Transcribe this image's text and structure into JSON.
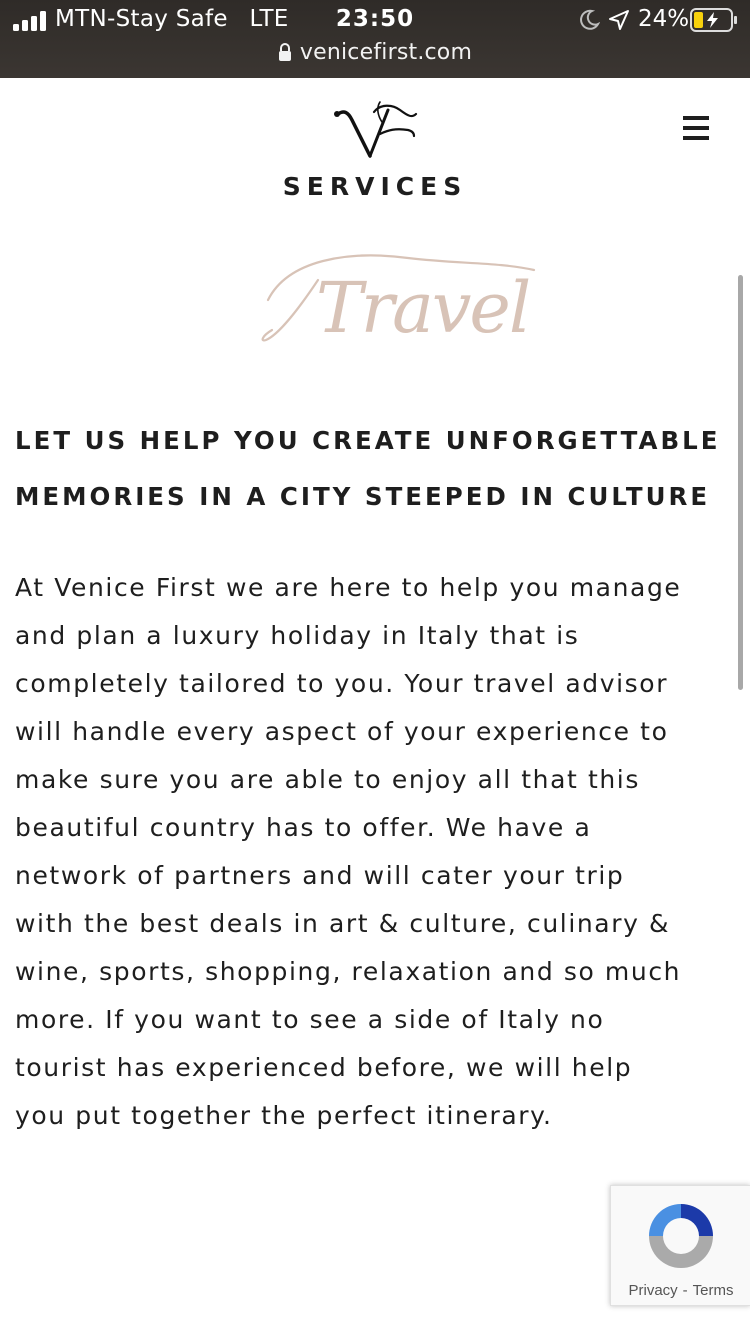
{
  "status_bar": {
    "carrier": "MTN-Stay Safe",
    "network": "LTE",
    "time": "23:50",
    "battery_percent": "24%",
    "icons": [
      "signal-bars-icon",
      "moon-icon",
      "location-arrow-icon",
      "battery-charging-icon"
    ]
  },
  "browser": {
    "url": "venicefirst.com",
    "lock_icon": "lock-icon"
  },
  "header": {
    "logo": "VF monogram",
    "section_label": "SERVICES",
    "menu_icon": "hamburger-menu-icon"
  },
  "hero": {
    "script_title": "Travel",
    "script_color": "#d8c3b7"
  },
  "content": {
    "headline_line1": "LET US HELP YOU CREATE UNFORGETTABLE",
    "headline_line2": "MEMORIES IN A CITY STEEPED IN CULTURE",
    "body_lines": [
      "At Venice First we are here to help you manage",
      "and plan a luxury holiday in Italy that is",
      "completely tailored to you. Your travel advisor",
      "will handle every aspect of your experience to",
      "make sure you are able to enjoy all that this",
      "beautiful country has to offer. We have a",
      "network of partners and will cater your trip",
      "with the best deals in art & culture, culinary &",
      "wine, sports, shopping, relaxation and so much",
      "more. If you want to see a side of Italy no",
      "tourist has experienced before, we will help",
      "you put together the perfect itinerary."
    ]
  },
  "recaptcha": {
    "privacy_label": "Privacy",
    "separator": "-",
    "terms_label": "Terms"
  },
  "colors": {
    "topbar": "#35302c",
    "text": "#1e1e1e",
    "accent_script": "#d8c3b7",
    "recaptcha_blue": "#1c3aa9",
    "recaptcha_light_blue": "#4a90e2",
    "recaptcha_gray": "#aaaaaa"
  }
}
